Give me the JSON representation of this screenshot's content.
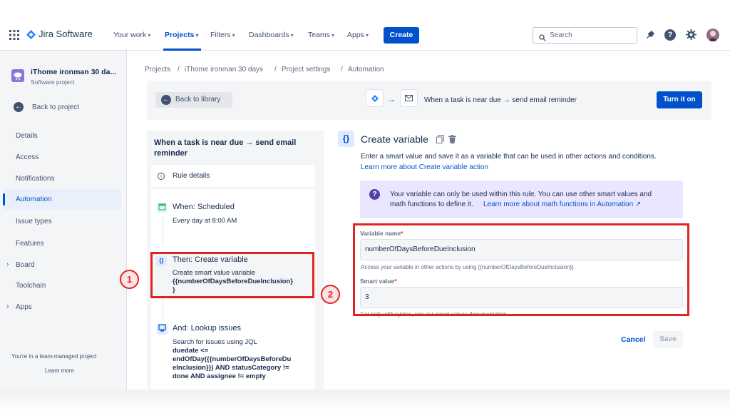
{
  "nav": {
    "logo": "Jira Software",
    "items": [
      "Your work",
      "Projects",
      "Filters",
      "Dashboards",
      "Teams",
      "Apps"
    ],
    "create": "Create",
    "search_placeholder": "Search"
  },
  "sidebar": {
    "project_name": "iThome ironman 30 da...",
    "project_type": "Software project",
    "back": "Back to project",
    "items": [
      "Details",
      "Access",
      "Notifications",
      "Automation",
      "Issue types",
      "Features",
      "Board",
      "Toolchain",
      "Apps"
    ],
    "footer": "You're in a team-managed project",
    "learn_more": "Learn more"
  },
  "breadcrumb": [
    "Projects",
    "iThome ironman 30 days",
    "Project settings",
    "Automation"
  ],
  "header": {
    "back_library": "Back to library",
    "rule_title": "When a task is near due → send email reminder",
    "turn_on": "Turn it on"
  },
  "rule": {
    "title_line1": "When a task is near due → send email",
    "title_line2": "reminder",
    "details": "Rule details",
    "when_title": "When: Scheduled",
    "when_desc": "Every day at 8:00 AM",
    "then_title": "Then: Create variable",
    "then_desc": "Create smart value variable",
    "then_var": "{{numberOfDaysBeforeDueInclusion}",
    "then_var2": "}",
    "and_title": "And: Lookup issues",
    "and_desc": "Search for issues using JQL",
    "jql": [
      "duedate <=",
      "endOfDay({{numberOfDaysBeforeDu",
      "eInclusion}}) AND statusCategory !=",
      "done AND assignee != empty"
    ]
  },
  "panel": {
    "title": "Create variable",
    "desc": "Enter a smart value and save it as a variable that can be used in other actions and conditions.",
    "learn_link": "Learn more about Create variable action",
    "info_text1": "Your variable can only be used within this rule. You can use other smart values and",
    "info_text2": "math functions to define it.",
    "info_link": "Learn more about math functions in Automation ↗",
    "var_label": "Variable name",
    "var_value": "numberOfDaysBeforeDueInclusion",
    "var_help": "Access your variable in other actions by using {{numberOfDaysBeforeDueInclusion}}",
    "smart_label": "Smart value",
    "smart_value": "3",
    "smart_help": "For help with syntax, see our smart values documentation.",
    "cancel": "Cancel",
    "save": "Save"
  },
  "annotations": [
    "1",
    "2"
  ],
  "colors": {
    "brand": "#0052cc",
    "highlight": "#e02424"
  }
}
